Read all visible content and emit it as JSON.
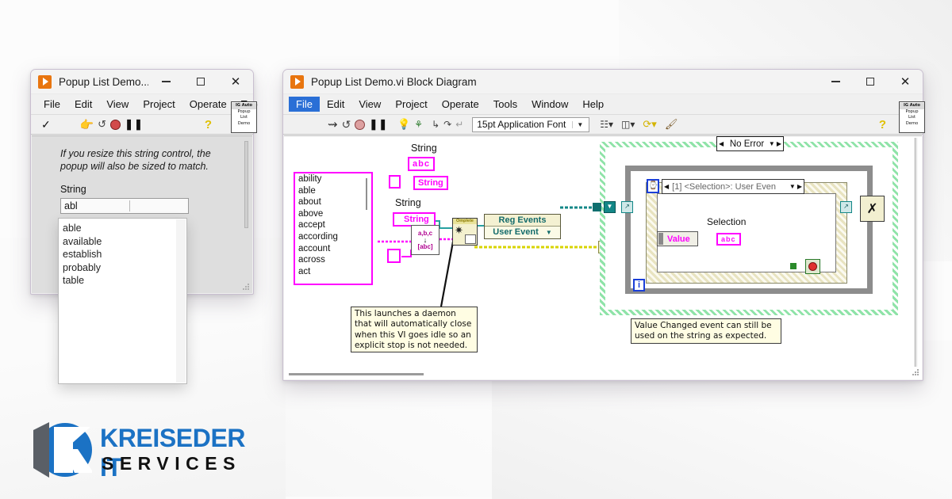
{
  "front_panel": {
    "title": "Popup List Demo...",
    "window_buttons": {
      "minimize": "minimize-button",
      "maximize": "maximize-button",
      "close": "close-button"
    },
    "menu": [
      "File",
      "Edit",
      "View",
      "Project",
      "Operate",
      "Too"
    ],
    "toolbar_icons": [
      "run-arrow-check",
      "run-continuously",
      "abort-execution",
      "pause",
      "help-question"
    ],
    "vi_badge": {
      "header": "IG Auto",
      "line1": "Popup",
      "line2": "List",
      "line3": "Demo"
    },
    "note": "If you resize this string control, the popup will also be sized to match.",
    "string_label": "String",
    "string_value": "abl"
  },
  "popup_list": {
    "items": [
      "able",
      "available",
      "establish",
      "probably",
      "table"
    ]
  },
  "block_diagram": {
    "title": "Popup List Demo.vi Block Diagram",
    "menu": [
      "File",
      "Edit",
      "View",
      "Project",
      "Operate",
      "Tools",
      "Window",
      "Help"
    ],
    "menu_selected": "File",
    "toolbar_icons": [
      "run-arrow",
      "run-continuously",
      "abort-execution",
      "pause",
      "highlight-execution",
      "retain-wire-values",
      "step-into",
      "step-over",
      "step-out"
    ],
    "font_selector": {
      "value": "15pt Application Font",
      "arrow": "chevron-down-icon"
    },
    "toolbar_right_icons": [
      "align-objects",
      "distribute-objects",
      "reorder",
      "clean-up-diagram"
    ],
    "help_icon": "help-question-icon",
    "vi_badge": {
      "header": "IG Auto",
      "line1": "Popup",
      "line2": "List",
      "line3": "Demo"
    },
    "diagram": {
      "string_array_items": [
        "ability",
        "able",
        "about",
        "above",
        "accept",
        "according",
        "account",
        "across",
        "act"
      ],
      "label_string_top": "String",
      "string_constant_abc": "abc",
      "property_node_label": "String",
      "control_ref_label": "String",
      "ctrl_ref_text": "String",
      "convert_node_top": "a,b,c",
      "convert_node_bottom": "[abc]",
      "launch_node_caption": "Omplete",
      "reg_events": {
        "title": "Reg Events",
        "event_row": "User Event",
        "arrow": "chevron-down-icon"
      },
      "error_selector": "No Error",
      "event_case": "[1] <Selection>: User Even",
      "event_terminal_label": "Value",
      "selection_label": "Selection",
      "selection_indicator": "abc",
      "loop_index_label": "i",
      "stop_terminal": "stop-button-terminal",
      "comment_left": "This launches a daemon that will automatically close when this VI goes idle so an explicit stop is not needed.",
      "comment_right": "Value Changed event can still be used on the string as expected."
    }
  },
  "logo": {
    "line1": "KREISEDER IT",
    "line2": "SERVICES",
    "brand_blue": "#1b72c4",
    "mark": "K-monogram-in-circle"
  }
}
